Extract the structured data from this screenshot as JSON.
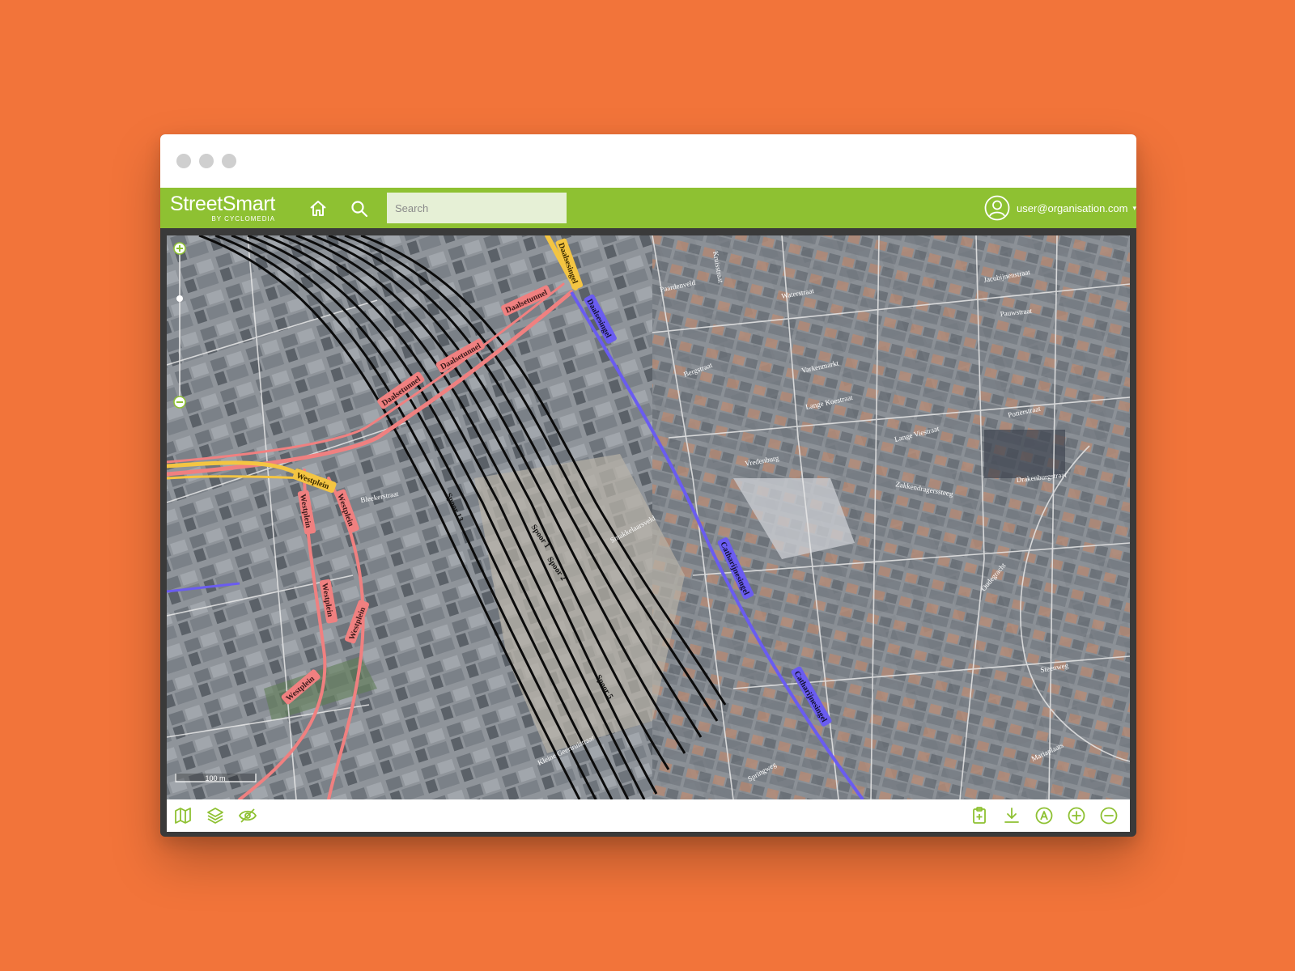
{
  "app": {
    "logo_text": "StreetSmart",
    "logo_subtext": "BY CYCLOMEDIA",
    "brand_color": "#8ec132",
    "background_color": "#f2743a"
  },
  "header": {
    "home_icon": "home-icon",
    "search_icon": "search-icon",
    "search_placeholder": "Search",
    "user_email": "user@organisation.com",
    "user_icon": "user-icon"
  },
  "map": {
    "scale_label": "100 m",
    "line_colors": {
      "rail": "#111111",
      "tunnel": "#f08080",
      "highway": "#f4c542",
      "ring": "#6a5cf0"
    },
    "route_labels": [
      "Daalsetunnel",
      "Daalsetunnel",
      "Daalsetunnel",
      "Daalsesingel",
      "Daalsesingel",
      "Westplein",
      "Westplein",
      "Westplein",
      "Westplein",
      "Westplein",
      "Westplein",
      "Catharijnesingel",
      "Catharijnesingel",
      "Spoor 13",
      "Spoor 1",
      "Spoor 2",
      "Spoor 5"
    ],
    "street_labels": [
      "Paardenveld",
      "Waterstraat",
      "Jacobijnenstraat",
      "Pauwstraat",
      "Varkenmarkt",
      "Lange Koestraat",
      "Vredenburg",
      "Potterstraat",
      "Lange Viestraat",
      "Zakkendragerssteeg",
      "Drakenburgstraat",
      "Bergstraat",
      "Kruisstraat",
      "Bleekerstraat",
      "Smakkelaarsveld",
      "Oudegracht",
      "Mariaplaats",
      "Springweg",
      "Steenweg",
      "Kleine Geertruistraat"
    ]
  },
  "bottom_toolbar": {
    "left": [
      "map-icon",
      "layers-icon",
      "visibility-off-icon"
    ],
    "right": [
      "clipboard-add-icon",
      "download-icon",
      "measure-icon",
      "zoom-in-icon",
      "zoom-out-icon"
    ]
  }
}
